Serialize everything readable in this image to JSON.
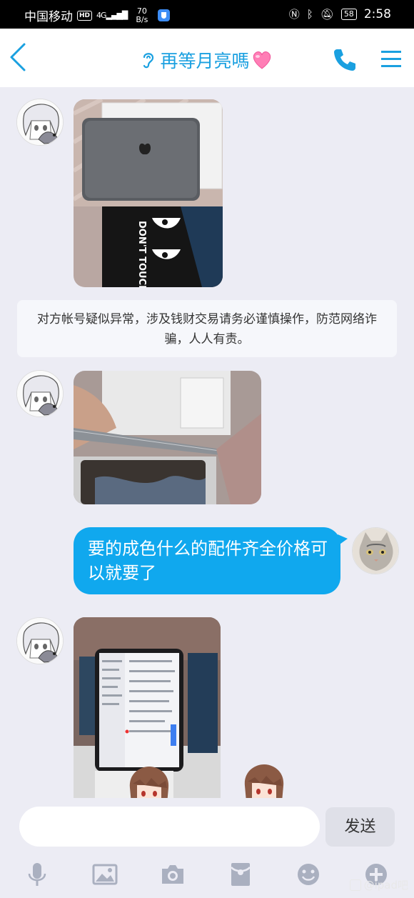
{
  "status_bar": {
    "carrier": "中国移动",
    "hd": "HD",
    "signal": "4G",
    "speed_value": "70",
    "speed_unit": "B/s",
    "battery": "58",
    "time": "2:58"
  },
  "header": {
    "title": "再等月亮嗎",
    "title_emoji": "heart",
    "accent_color": "#1aa0e0"
  },
  "messages": [
    {
      "type": "image",
      "side": "left",
      "content": "photo of iPad box and cover printed DON'T TOUCH ME",
      "cover_text": "DON'T TOUCH ME"
    },
    {
      "type": "notice",
      "text": "对方帐号疑似异常，涉及钱财交易请务必谨慎操作，防范网络诈骗，人人有责。"
    },
    {
      "type": "image",
      "side": "left",
      "content": "photo of iPad edge in hand"
    },
    {
      "type": "text",
      "side": "right",
      "text": "要的成色什么的配件齐全价格可以就要了"
    },
    {
      "type": "image",
      "side": "left",
      "content": "photo of iPad screen with settings"
    }
  ],
  "input": {
    "placeholder": "",
    "send_label": "发送"
  },
  "toolbar": [
    "mic-icon",
    "image-icon",
    "camera-icon",
    "red-packet-icon",
    "emoji-icon",
    "plus-icon"
  ],
  "watermark": "@ipad吧",
  "colors": {
    "bubble": "#10a8ee",
    "background": "#ececf4"
  }
}
